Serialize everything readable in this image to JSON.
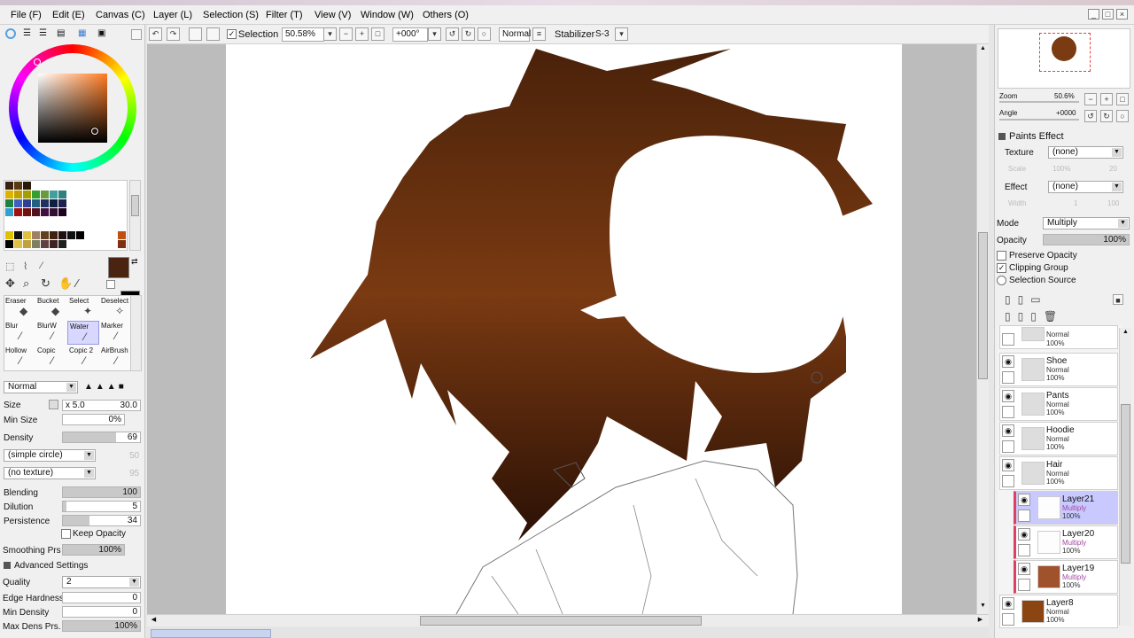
{
  "menu": [
    "File (F)",
    "Edit (E)",
    "Canvas (C)",
    "Layer (L)",
    "Selection (S)",
    "Filter (T)",
    "View (V)",
    "Window (W)",
    "Others (O)"
  ],
  "toolbar": {
    "selection_label": "Selection",
    "zoom": "50.58%",
    "angle": "+000°",
    "blend": "Normal",
    "stabilizer_label": "Stabilizer",
    "stabilizer_value": "S-3"
  },
  "navigator": {
    "zoom_label": "Zoom",
    "zoom_value": "50.6%",
    "angle_label": "Angle",
    "angle_value": "+0000"
  },
  "paints_effect": {
    "title": "Paints Effect",
    "texture_label": "Texture",
    "texture_value": "(none)",
    "scale_label": "Scale",
    "scale_value": "100%",
    "scale_num": "20",
    "effect_label": "Effect",
    "effect_value": "(none)",
    "width_label": "Width",
    "width_value": "1",
    "width_num": "100"
  },
  "layer_props": {
    "mode_label": "Mode",
    "mode_value": "Multiply",
    "opacity_label": "Opacity",
    "opacity_value": "100%",
    "preserve_opacity": "Preserve Opacity",
    "clipping_group": "Clipping Group",
    "selection_source": "Selection Source"
  },
  "layers": [
    {
      "name": "",
      "mode": "Normal",
      "opacity": "100%",
      "type": "folder"
    },
    {
      "name": "Shoe",
      "mode": "Normal",
      "opacity": "100%",
      "type": "folder"
    },
    {
      "name": "Pants",
      "mode": "Normal",
      "opacity": "100%",
      "type": "folder"
    },
    {
      "name": "Hoodie",
      "mode": "Normal",
      "opacity": "100%",
      "type": "folder"
    },
    {
      "name": "Hair",
      "mode": "Normal",
      "opacity": "100%",
      "type": "folder"
    },
    {
      "name": "Layer21",
      "mode": "Multiply",
      "opacity": "100%",
      "type": "sub",
      "selected": true
    },
    {
      "name": "Layer20",
      "mode": "Multiply",
      "opacity": "100%",
      "type": "sub"
    },
    {
      "name": "Layer19",
      "mode": "Multiply",
      "opacity": "100%",
      "type": "sub"
    },
    {
      "name": "Layer8",
      "mode": "Normal",
      "opacity": "100%",
      "type": "layer"
    }
  ],
  "tools": [
    {
      "label": "Eraser"
    },
    {
      "label": "Bucket"
    },
    {
      "label": "Select"
    },
    {
      "label": "Deselect"
    },
    {
      "label": "Blur"
    },
    {
      "label": "BlurW"
    },
    {
      "label": "Water"
    },
    {
      "label": "Marker"
    },
    {
      "label": "Hollow"
    },
    {
      "label": "Copic"
    },
    {
      "label": "Copic 2"
    },
    {
      "label": "AirBrush"
    }
  ],
  "brush": {
    "blend_mode": "Normal",
    "size_label": "Size",
    "size_mult": "x 5.0",
    "size_value": "30.0",
    "minsize_label": "Min Size",
    "minsize_value": "0%",
    "density_label": "Density",
    "density_value": "69",
    "shape": "(simple circle)",
    "shape_num": "50",
    "texture": "(no texture)",
    "texture_num": "95",
    "blending_label": "Blending",
    "blending_value": "100",
    "dilution_label": "Dilution",
    "dilution_value": "5",
    "persistence_label": "Persistence",
    "persistence_value": "34",
    "keep_opacity": "Keep Opacity",
    "smoothing_label": "Smoothing Prs",
    "smoothing_value": "100%",
    "advanced_title": "Advanced Settings",
    "quality_label": "Quality",
    "quality_value": "2",
    "edge_label": "Edge Hardness",
    "edge_value": "0",
    "mindensity_label": "Min Density",
    "mindensity_value": "0",
    "maxdens_label": "Max Dens Prs.",
    "maxdens_value": "100%"
  },
  "colors": {
    "primary": "#4a2410",
    "secondary": "#000000",
    "hair": "#6b3310",
    "canvas_bg": "#bcbcbc",
    "selected_layer": "#c9c9ff",
    "clip_marker": "#e04060"
  }
}
